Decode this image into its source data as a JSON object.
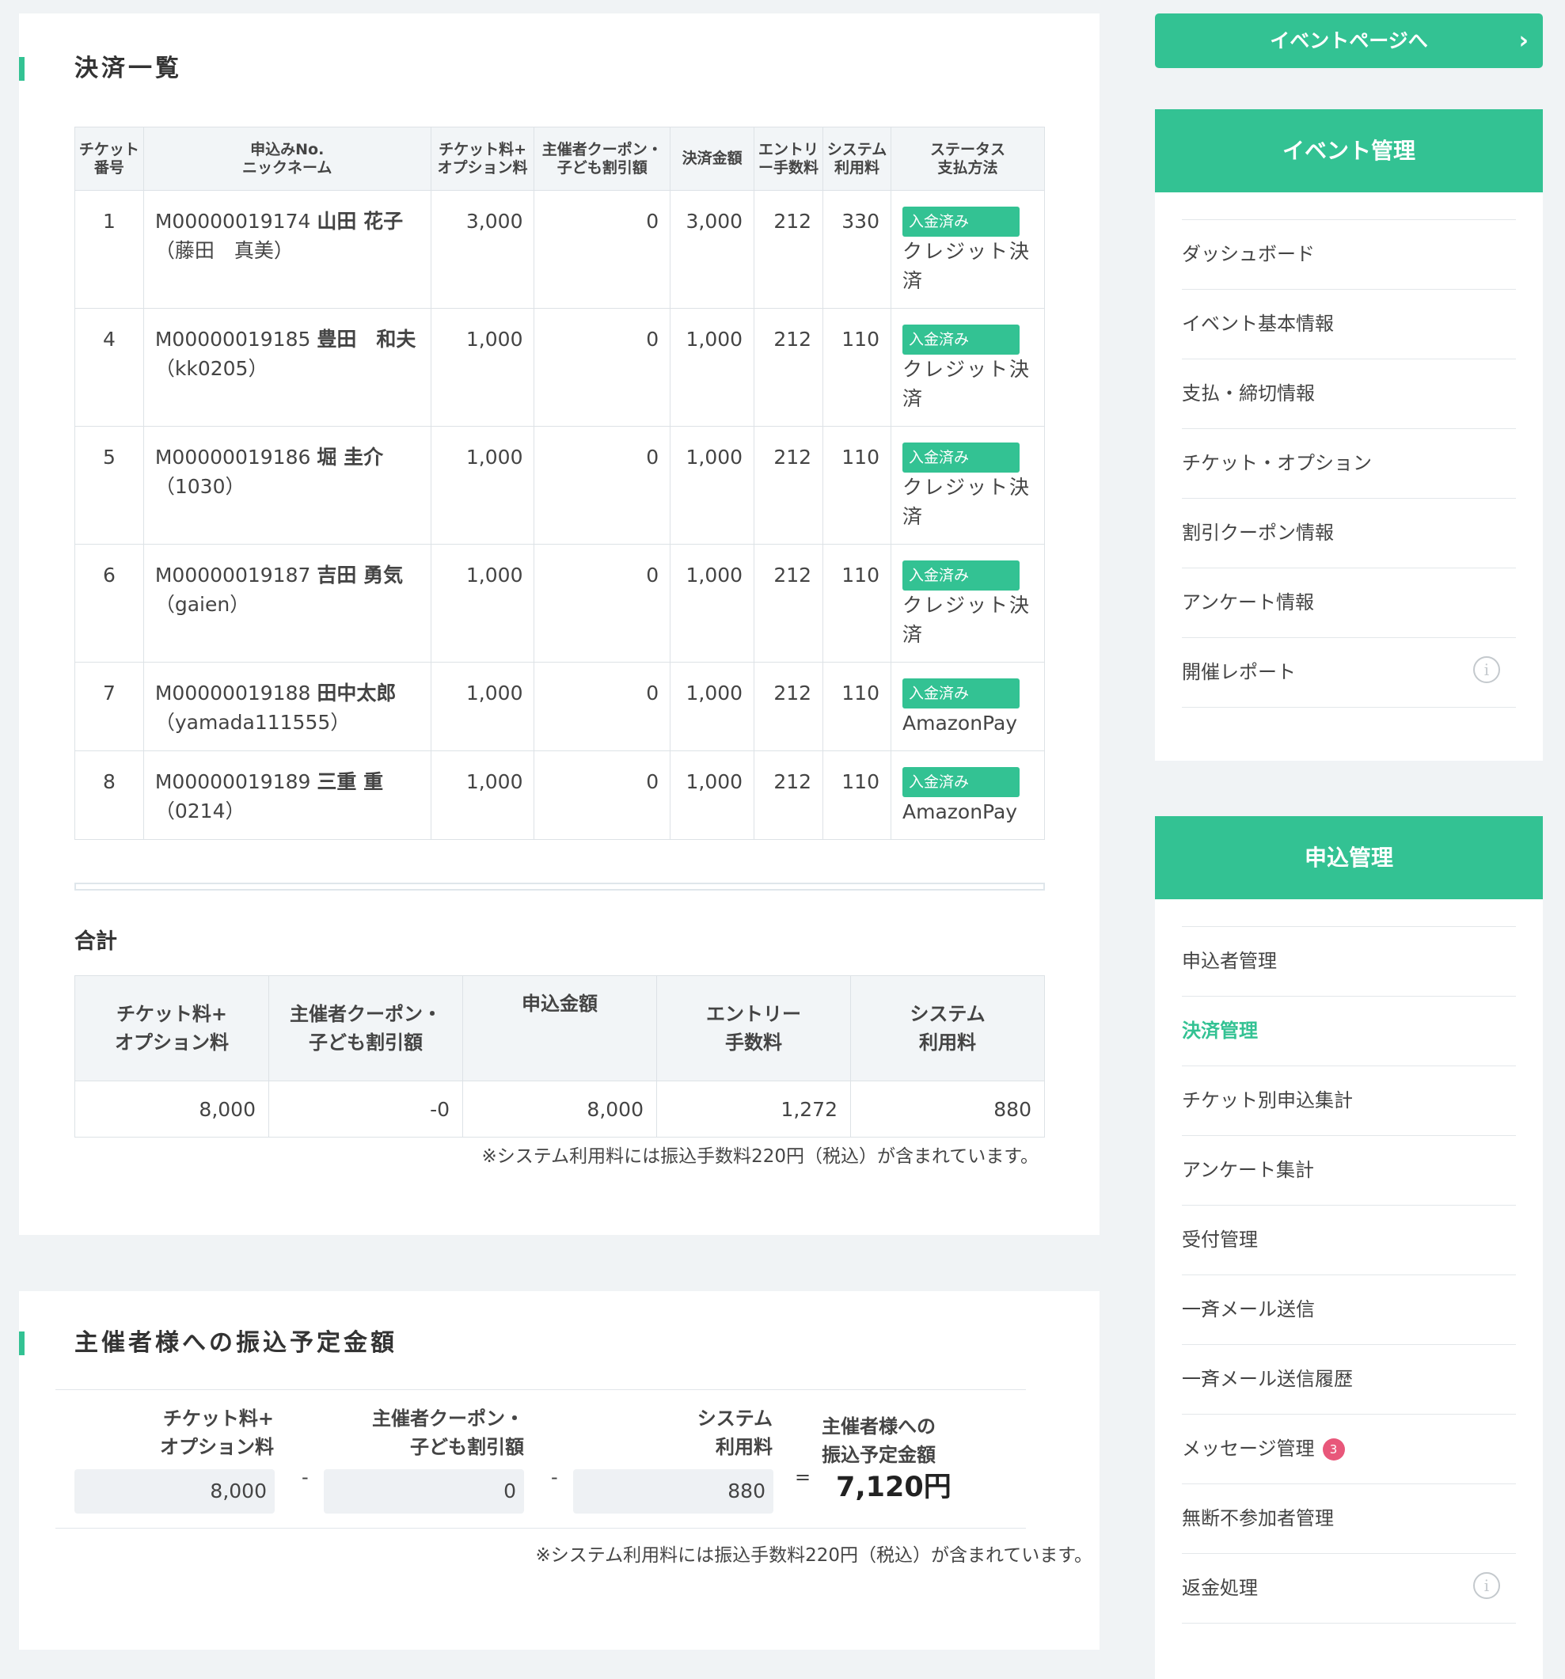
{
  "payments": {
    "title": "決済一覧",
    "headers": {
      "ticket_no": "チケット\n番号",
      "app_no": "申込みNo.\nニックネーム",
      "ticket_fee": "チケット料+\nオプション料",
      "coupon": "主催者クーポン・\n子ども割引額",
      "paid": "決済金額",
      "entry_fee": "エントリ\nー手数料",
      "system_fee": "システム\n利用料",
      "status": "ステータス\n支払方法"
    },
    "rows": [
      {
        "no": "1",
        "app": "M00000019174",
        "name": "山田 花子",
        "nick": "（藤田　真美）",
        "fee": "3,000",
        "coupon": "0",
        "paid": "3,000",
        "entry": "212",
        "system": "330",
        "status": "入金済み",
        "method": "クレジット決済"
      },
      {
        "no": "4",
        "app": "M00000019185",
        "name": "豊田　和夫",
        "nick": "（kk0205）",
        "fee": "1,000",
        "coupon": "0",
        "paid": "1,000",
        "entry": "212",
        "system": "110",
        "status": "入金済み",
        "method": "クレジット決済"
      },
      {
        "no": "5",
        "app": "M00000019186",
        "name": "堀 圭介",
        "nick": "（1030）",
        "fee": "1,000",
        "coupon": "0",
        "paid": "1,000",
        "entry": "212",
        "system": "110",
        "status": "入金済み",
        "method": "クレジット決済"
      },
      {
        "no": "6",
        "app": "M00000019187",
        "name": "吉田 勇気",
        "nick": "（gaien）",
        "fee": "1,000",
        "coupon": "0",
        "paid": "1,000",
        "entry": "212",
        "system": "110",
        "status": "入金済み",
        "method": "クレジット決済"
      },
      {
        "no": "7",
        "app": "M00000019188",
        "name": "田中太郎",
        "nick": "（yamada111555）",
        "fee": "1,000",
        "coupon": "0",
        "paid": "1,000",
        "entry": "212",
        "system": "110",
        "status": "入金済み",
        "method": "AmazonPay"
      },
      {
        "no": "8",
        "app": "M00000019189",
        "name": "三重 重",
        "nick": "（0214）",
        "fee": "1,000",
        "coupon": "0",
        "paid": "1,000",
        "entry": "212",
        "system": "110",
        "status": "入金済み",
        "method": "AmazonPay"
      }
    ]
  },
  "summary": {
    "title": "合計",
    "headers": {
      "ticket_fee": "チケット料+\nオプション料",
      "coupon": "主催者クーポン・\n子ども割引額",
      "apply": "申込金額",
      "entry": "エントリー\n手数料",
      "system": "システム\n利用料"
    },
    "values": {
      "ticket_fee": "8,000",
      "coupon": "-0",
      "apply": "8,000",
      "entry": "1,272",
      "system": "880"
    },
    "note": "※システム利用料には振込手数料220円（税込）が含まれています。"
  },
  "transfer": {
    "title": "主催者様への振込予定金額",
    "labels": {
      "ticket_fee": "チケット料+\nオプション料",
      "coupon": "主催者クーポン・\n子ども割引額",
      "system": "システム\n利用料",
      "total": "主催者様への\n振込予定金額"
    },
    "values": {
      "ticket_fee": "8,000",
      "coupon": "0",
      "system": "880",
      "total": "7,120円"
    },
    "ops": {
      "minus": "-",
      "equals": "="
    },
    "note": "※システム利用料には振込手数料220円（税込）が含まれています。"
  },
  "sidebar": {
    "event_page_button": "イベントページへ",
    "event_panel": {
      "title": "イベント管理",
      "items": [
        "ダッシュボード",
        "イベント基本情報",
        "支払・締切情報",
        "チケット・オプション",
        "割引クーポン情報",
        "アンケート情報",
        "開催レポート"
      ]
    },
    "apply_panel": {
      "title": "申込管理",
      "items": [
        "申込者管理",
        "決済管理",
        "チケット別申込集計",
        "アンケート集計",
        "受付管理",
        "一斉メール送信",
        "一斉メール送信履歴",
        "メッセージ管理",
        "無断不参加者管理",
        "返金処理"
      ],
      "message_count": "3"
    },
    "colors": {
      "accent": "#33c293",
      "badge": "#e8577a"
    }
  }
}
